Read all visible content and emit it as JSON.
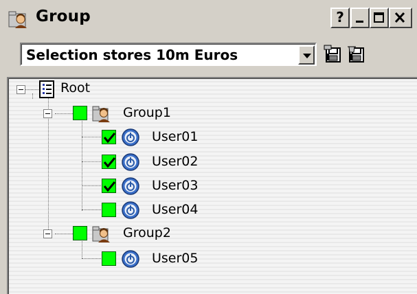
{
  "window": {
    "title": "Group",
    "buttons": {
      "help": "?",
      "minimize": "_",
      "maximize": "□",
      "close": "×"
    }
  },
  "selection": {
    "value": "Selection stores 10m Euros"
  },
  "tree": {
    "root": {
      "label": "Root"
    },
    "groups": [
      {
        "label": "Group1",
        "checked": false,
        "users": [
          {
            "label": "User01",
            "checked": true
          },
          {
            "label": "User02",
            "checked": true
          },
          {
            "label": "User03",
            "checked": true
          },
          {
            "label": "User04",
            "checked": false
          }
        ]
      },
      {
        "label": "Group2",
        "checked": false,
        "users": [
          {
            "label": "User05",
            "checked": false
          }
        ]
      }
    ]
  },
  "colors": {
    "checkbox_fill": "#00ff00",
    "user_icon": "#2a5aa8",
    "window_bg": "#d4d0c8"
  }
}
